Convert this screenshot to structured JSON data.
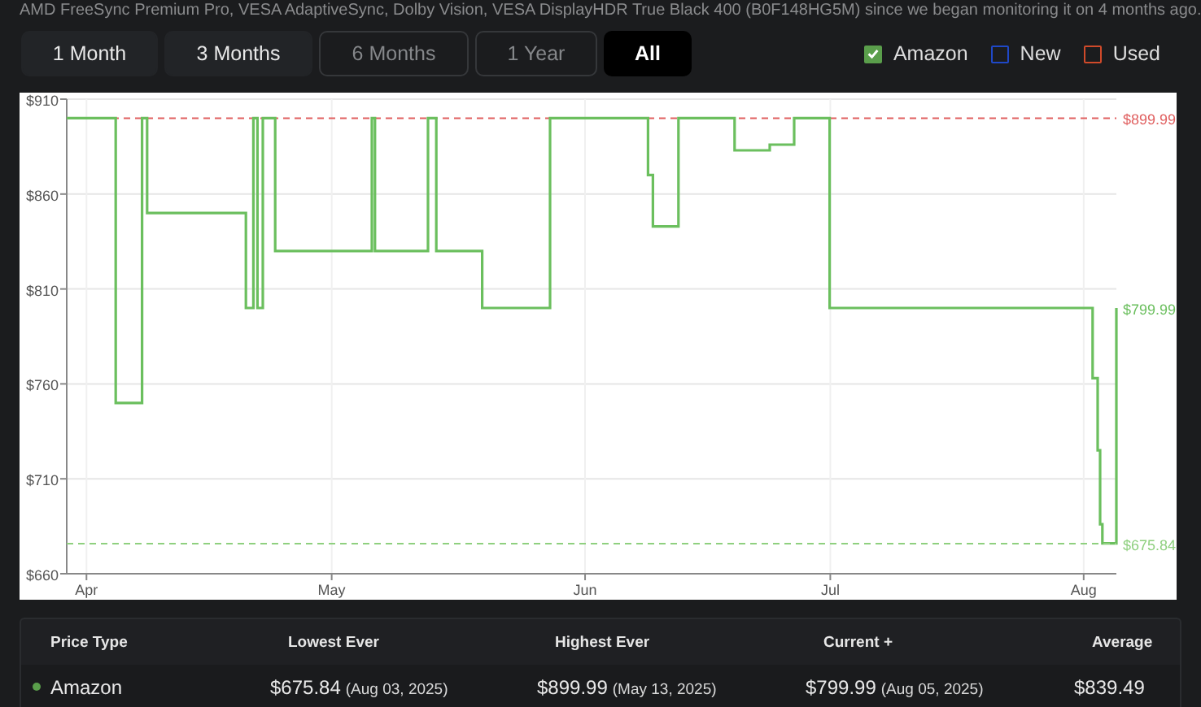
{
  "intro_text": "AMD FreeSync Premium Pro, VESA AdaptiveSync, Dolby Vision, VESA DisplayHDR True Black 400 (B0F148HG5M) since we began monitoring it on 4 months ago.",
  "range_tabs": [
    {
      "label": "1 Month",
      "selected": false,
      "disabled": false
    },
    {
      "label": "3 Months",
      "selected": false,
      "disabled": false
    },
    {
      "label": "6 Months",
      "selected": false,
      "disabled": true
    },
    {
      "label": "1 Year",
      "selected": false,
      "disabled": true
    },
    {
      "label": "All",
      "selected": true,
      "disabled": false
    }
  ],
  "legend": [
    {
      "label": "Amazon",
      "checked": true,
      "color": "#5a9e4b"
    },
    {
      "label": "New",
      "checked": false,
      "color": "#1f48c8"
    },
    {
      "label": "Used",
      "checked": false,
      "color": "#d04a2a"
    }
  ],
  "price_chart": {
    "chart_data": {
      "type": "line",
      "grid": true,
      "x": [
        "2025-03-29T14:00",
        "2025-04-04T14:00",
        "2025-04-04T14:00",
        "2025-04-07T19:00",
        "2025-04-07T19:00",
        "2025-04-08T10:00",
        "2025-04-08T10:00",
        "2025-04-20T12:00",
        "2025-04-20T12:00",
        "2025-04-21T10:00",
        "2025-04-21T10:00",
        "2025-04-21T22:00",
        "2025-04-21T22:00",
        "2025-04-22T14:00",
        "2025-04-22T14:00",
        "2025-04-24T02:00",
        "2025-04-24T02:00",
        "2025-05-05T22:00",
        "2025-05-05T22:00",
        "2025-05-06T07:00",
        "2025-05-06T07:00",
        "2025-05-12T19:00",
        "2025-05-12T19:00",
        "2025-05-13T19:00",
        "2025-05-13T19:00",
        "2025-05-19T10:00",
        "2025-05-19T10:00",
        "2025-05-27T17:00",
        "2025-05-27T17:00",
        "2025-06-08T17:00",
        "2025-06-08T17:00",
        "2025-06-09T07:00",
        "2025-06-09T07:00",
        "2025-06-12T10:00",
        "2025-06-12T10:00",
        "2025-06-19T07:00",
        "2025-06-19T07:00",
        "2025-06-23T14:00",
        "2025-06-23T14:00",
        "2025-06-26T14:00",
        "2025-06-26T14:00",
        "2025-06-30T22:00",
        "2025-06-30T22:00",
        "2025-08-02T02:00",
        "2025-08-02T02:00",
        "2025-08-02T17:00",
        "2025-08-02T17:00",
        "2025-08-03T00:00",
        "2025-08-03T00:00",
        "2025-08-03T07:00",
        "2025-08-03T07:00",
        "2025-08-05T00:00",
        "2025-08-05T00:00"
      ],
      "series": [
        {
          "color": "#e06060",
          "line_style": "dashed",
          "values": [
            899.99,
            899.99,
            899.99,
            899.99,
            899.99,
            899.99,
            899.99,
            899.99,
            899.99,
            899.99,
            899.99,
            899.99,
            899.99,
            899.99,
            899.99,
            899.99,
            899.99,
            899.99,
            899.99,
            899.99,
            899.99,
            899.99,
            899.99,
            899.99,
            899.99,
            899.99,
            899.99,
            899.99,
            899.99,
            899.99,
            899.99,
            899.99,
            899.99,
            899.99,
            899.99,
            899.99,
            899.99,
            899.99,
            899.99,
            899.99,
            899.99,
            899.99,
            899.99,
            899.99,
            899.99,
            899.99,
            899.99,
            899.99,
            899.99,
            899.99,
            899.99,
            899.99,
            899.99
          ]
        },
        {
          "color": "#6bbf5e",
          "line_style": "solid",
          "values": [
            900,
            900,
            750,
            750,
            900,
            900,
            850,
            850,
            800,
            800,
            900,
            900,
            800,
            800,
            900,
            900,
            830,
            830,
            900,
            900,
            830,
            830,
            900,
            900,
            830,
            830,
            800,
            800,
            900,
            900,
            870,
            870,
            843,
            843,
            900,
            900,
            883,
            883,
            886,
            886,
            900,
            900,
            800,
            800,
            763,
            763,
            725,
            725,
            686,
            686,
            676,
            676,
            800
          ]
        },
        {
          "color": "#8fd07f",
          "line_style": "dashed",
          "values": [
            675.84,
            675.84,
            675.84,
            675.84,
            675.84,
            675.84,
            675.84,
            675.84,
            675.84,
            675.84,
            675.84,
            675.84,
            675.84,
            675.84,
            675.84,
            675.84,
            675.84,
            675.84,
            675.84,
            675.84,
            675.84,
            675.84,
            675.84,
            675.84,
            675.84,
            675.84,
            675.84,
            675.84,
            675.84,
            675.84,
            675.84,
            675.84,
            675.84,
            675.84,
            675.84,
            675.84,
            675.84,
            675.84,
            675.84,
            675.84,
            675.84,
            675.84,
            675.84,
            675.84,
            675.84,
            675.84,
            675.84,
            675.84,
            675.84,
            675.84,
            675.84,
            675.84,
            675.84
          ]
        }
      ],
      "xlim": [
        "2025-03-29T14:00",
        "2025-08-05T00:00"
      ],
      "ylim": [
        660,
        910
      ],
      "xticks": [
        {
          "value": "2025-04-01",
          "label": "Apr"
        },
        {
          "value": "2025-05-01",
          "label": "May"
        },
        {
          "value": "2025-06-01",
          "label": "Jun"
        },
        {
          "value": "2025-07-01",
          "label": "Jul"
        },
        {
          "value": "2025-08-01",
          "label": "Aug"
        }
      ],
      "yticks": [
        {
          "value": 660,
          "label": "$660"
        },
        {
          "value": 710,
          "label": "$710"
        },
        {
          "value": 760,
          "label": "$760"
        },
        {
          "value": 810,
          "label": "$810"
        },
        {
          "value": 860,
          "label": "$860"
        },
        {
          "value": 910,
          "label": "$910"
        }
      ]
    },
    "end_labels": [
      "$899.99",
      "$799.99",
      "$675.84"
    ]
  },
  "price_table": {
    "columns": [
      "Price Type",
      "Lowest Ever",
      "Highest Ever",
      "Current +",
      "Average"
    ],
    "rows": [
      {
        "name": "Amazon",
        "color": "#5a9e4b",
        "lowest": {
          "value": "$675.84",
          "date": "(Aug 03, 2025)"
        },
        "highest": {
          "value": "$899.99",
          "date": "(May 13, 2025)"
        },
        "current": {
          "value": "$799.99",
          "date": "(Aug 05, 2025)"
        },
        "average": "$839.49"
      }
    ]
  }
}
